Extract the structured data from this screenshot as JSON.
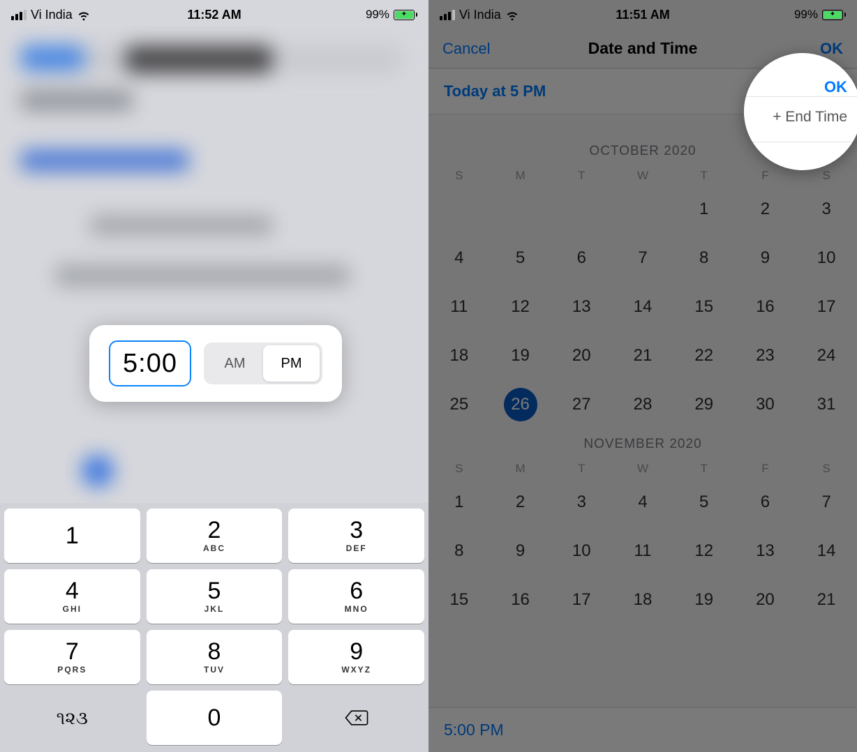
{
  "left": {
    "status": {
      "carrier": "Vi India",
      "time": "11:52 AM",
      "battery": "99%"
    },
    "time_picker": {
      "value": "5:00",
      "am": "AM",
      "pm": "PM",
      "selected": "PM"
    },
    "keypad": {
      "keys": [
        {
          "num": "1",
          "sub": ""
        },
        {
          "num": "2",
          "sub": "ABC"
        },
        {
          "num": "3",
          "sub": "DEF"
        },
        {
          "num": "4",
          "sub": "GHI"
        },
        {
          "num": "5",
          "sub": "JKL"
        },
        {
          "num": "6",
          "sub": "MNO"
        },
        {
          "num": "7",
          "sub": "PQRS"
        },
        {
          "num": "8",
          "sub": "TUV"
        },
        {
          "num": "9",
          "sub": "WXYZ"
        }
      ],
      "lang": "૧૨૩",
      "zero": "0"
    }
  },
  "right": {
    "status": {
      "carrier": "Vi India",
      "time": "11:51 AM",
      "battery": "99%"
    },
    "nav": {
      "cancel": "Cancel",
      "title": "Date and Time",
      "ok": "OK"
    },
    "summary": {
      "today": "Today at 5 PM",
      "end_time": "+ End Time"
    },
    "calendar": {
      "dow": [
        "S",
        "M",
        "T",
        "W",
        "T",
        "F",
        "S"
      ],
      "months": [
        {
          "label": "OCTOBER 2020",
          "weeks": [
            [
              "",
              "",
              "",
              "",
              "1",
              "2",
              "3"
            ],
            [
              "4",
              "5",
              "6",
              "7",
              "8",
              "9",
              "10"
            ],
            [
              "11",
              "12",
              "13",
              "14",
              "15",
              "16",
              "17"
            ],
            [
              "18",
              "19",
              "20",
              "21",
              "22",
              "23",
              "24"
            ],
            [
              "25",
              "26",
              "27",
              "28",
              "29",
              "30",
              "31"
            ]
          ],
          "selected": "26"
        },
        {
          "label": "NOVEMBER 2020",
          "weeks": [
            [
              "1",
              "2",
              "3",
              "4",
              "5",
              "6",
              "7"
            ],
            [
              "8",
              "9",
              "10",
              "11",
              "12",
              "13",
              "14"
            ],
            [
              "15",
              "16",
              "17",
              "18",
              "19",
              "20",
              "21"
            ]
          ],
          "selected": null
        }
      ]
    },
    "bottom_time": "5:00 PM",
    "spotlight": {
      "ok": "OK",
      "end_time": "+ End Time"
    }
  }
}
